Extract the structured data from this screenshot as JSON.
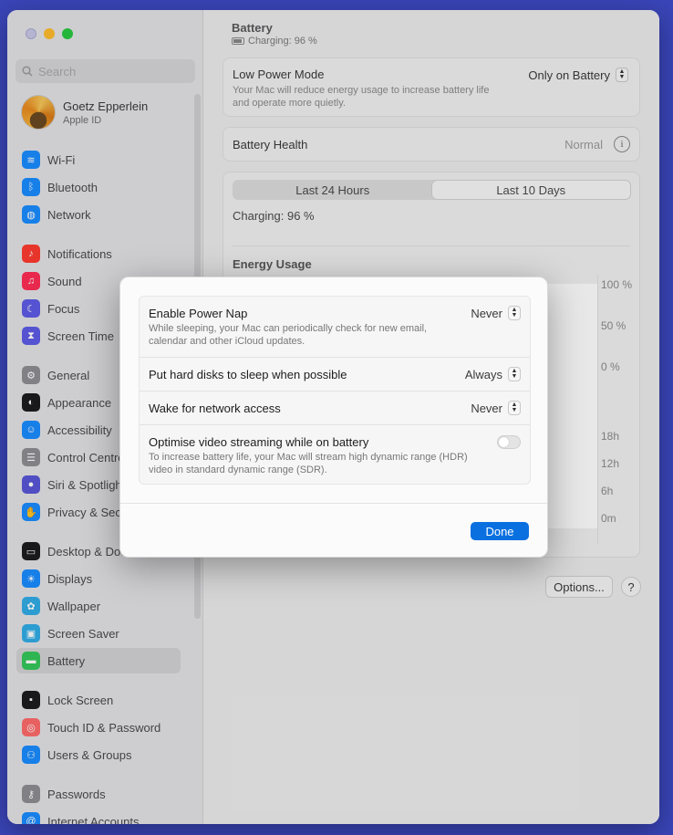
{
  "sidebar": {
    "search_placeholder": "Search",
    "user": {
      "name": "Goetz Epperlein",
      "subtitle": "Apple ID"
    },
    "items": [
      {
        "label": "Wi-Fi",
        "icon": "wifi-icon",
        "color": "#1a8cff"
      },
      {
        "label": "Bluetooth",
        "icon": "bluetooth-icon",
        "color": "#1a8cff"
      },
      {
        "label": "Network",
        "icon": "globe-icon",
        "color": "#1a8cff"
      },
      {
        "label": "Notifications",
        "icon": "bell-icon",
        "color": "#ff3b30"
      },
      {
        "label": "Sound",
        "icon": "speaker-icon",
        "color": "#ff2d55"
      },
      {
        "label": "Focus",
        "icon": "moon-icon",
        "color": "#5e5ce6"
      },
      {
        "label": "Screen Time",
        "icon": "hourglass-icon",
        "color": "#5e5ce6"
      },
      {
        "label": "General",
        "icon": "gear-icon",
        "color": "#8e8e93"
      },
      {
        "label": "Appearance",
        "icon": "appearance-icon",
        "color": "#1c1c1e"
      },
      {
        "label": "Accessibility",
        "icon": "accessibility-icon",
        "color": "#1a8cff"
      },
      {
        "label": "Control Centre",
        "icon": "control-centre-icon",
        "color": "#8e8e93"
      },
      {
        "label": "Siri & Spotlight",
        "icon": "siri-icon",
        "color": "#5856d6"
      },
      {
        "label": "Privacy & Security",
        "icon": "hand-icon",
        "color": "#1a8cff"
      },
      {
        "label": "Desktop & Dock",
        "icon": "dock-icon",
        "color": "#1c1c1e"
      },
      {
        "label": "Displays",
        "icon": "sun-icon",
        "color": "#1a8cff"
      },
      {
        "label": "Wallpaper",
        "icon": "flower-icon",
        "color": "#32ade6"
      },
      {
        "label": "Screen Saver",
        "icon": "screen-saver-icon",
        "color": "#32ade6"
      },
      {
        "label": "Battery",
        "icon": "battery-icon",
        "color": "#34c759"
      },
      {
        "label": "Lock Screen",
        "icon": "lock-icon",
        "color": "#1c1c1e"
      },
      {
        "label": "Touch ID & Password",
        "icon": "fingerprint-icon",
        "color": "#ff6b6b"
      },
      {
        "label": "Users & Groups",
        "icon": "users-icon",
        "color": "#1a8cff"
      },
      {
        "label": "Passwords",
        "icon": "key-icon",
        "color": "#8e8e93"
      },
      {
        "label": "Internet Accounts",
        "icon": "at-icon",
        "color": "#1a8cff"
      }
    ]
  },
  "header": {
    "title": "Battery",
    "subtitle": "Charging: 96 %"
  },
  "low_power": {
    "label": "Low Power Mode",
    "value": "Only on Battery",
    "description": "Your Mac will reduce energy usage to increase battery life and operate more quietly."
  },
  "battery_health": {
    "label": "Battery Health",
    "value": "Normal"
  },
  "history": {
    "tabs": [
      "Last 24 Hours",
      "Last 10 Days"
    ],
    "charging_text": "Charging: 96 %",
    "energy_title": "Energy Usage",
    "level_axis": [
      "100 %",
      "50 %",
      "0 %"
    ],
    "time_axis": [
      "18h",
      "12h",
      "6h",
      "0m"
    ]
  },
  "buttons": {
    "options": "Options...",
    "help": "?"
  },
  "sheet": {
    "rows": [
      {
        "title": "Enable Power Nap",
        "description": "While sleeping, your Mac can periodically check for new email, calendar and other iCloud updates.",
        "value": "Never"
      },
      {
        "title": "Put hard disks to sleep when possible",
        "value": "Always"
      },
      {
        "title": "Wake for network access",
        "value": "Never"
      },
      {
        "title": "Optimise video streaming while on battery",
        "description": "To increase battery life, your Mac will stream high dynamic range (HDR) video in standard dynamic range (SDR).",
        "toggle_on": false
      }
    ],
    "done_label": "Done"
  }
}
